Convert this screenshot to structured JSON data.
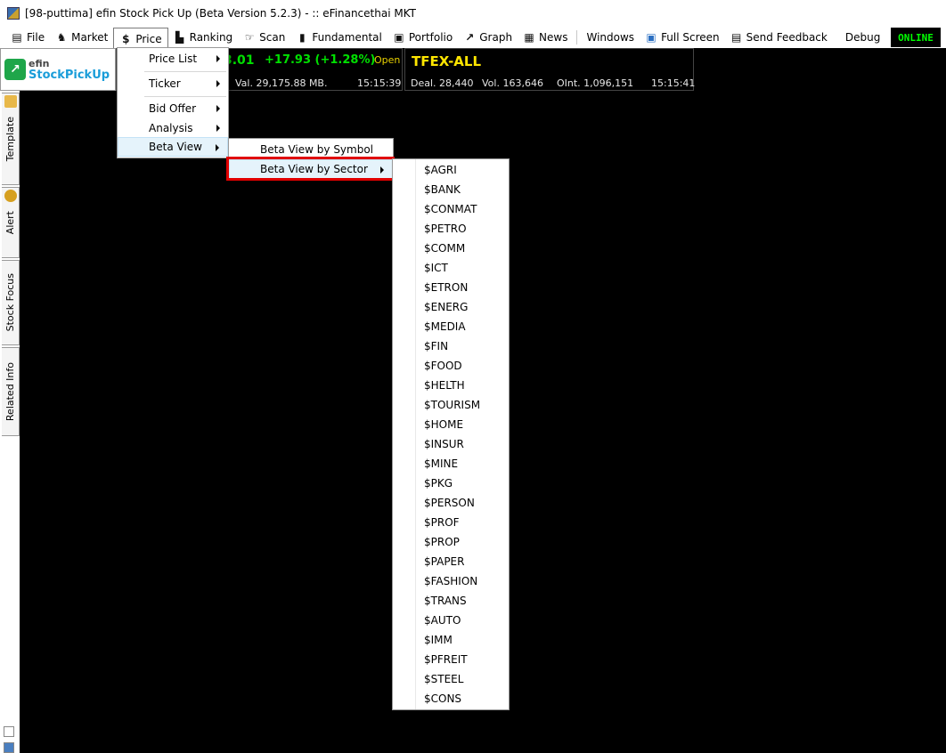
{
  "window": {
    "title": "[98-puttima] efin Stock Pick Up (Beta Version 5.2.3) - :: eFinancethai MKT"
  },
  "menubar": {
    "items": [
      {
        "label": "File",
        "icon": "document-icon"
      },
      {
        "label": "Market",
        "icon": "market-icon"
      },
      {
        "label": "Price",
        "icon": "dollar-icon"
      },
      {
        "label": "Ranking",
        "icon": "ranking-icon"
      },
      {
        "label": "Scan",
        "icon": "scan-icon"
      },
      {
        "label": "Fundamental",
        "icon": "fundamental-icon"
      },
      {
        "label": "Portfolio",
        "icon": "portfolio-icon"
      },
      {
        "label": "Graph",
        "icon": "graph-icon"
      },
      {
        "label": "News",
        "icon": "news-icon"
      },
      {
        "label": "Windows",
        "icon": ""
      },
      {
        "label": "Full Screen",
        "icon": "fullscreen-icon"
      },
      {
        "label": "Send Feedback",
        "icon": "feedback-icon"
      },
      {
        "label": "Debug",
        "icon": ""
      }
    ],
    "status": "ONLINE"
  },
  "logo": {
    "top": "efin",
    "bottom": "StockPickUp"
  },
  "ticker_set": {
    "index_partial": "3.01",
    "change": "+17.93 (+1.28%)",
    "state": "Open",
    "value": "Val. 29,175.88 MB.",
    "time": "15:15:39"
  },
  "ticker_tfex": {
    "name": "TFEX-ALL",
    "deal": "Deal. 28,440",
    "volume": "Vol. 163,646",
    "oint": "OInt. 1,096,151",
    "time": "15:15:41"
  },
  "left_tabs": [
    "Template",
    "Alert",
    "Stock Focus",
    "Related Info"
  ],
  "price_menu": {
    "items": [
      "Price List",
      "Ticker",
      "Bid Offer",
      "Analysis",
      "Beta View"
    ]
  },
  "beta_view_menu": {
    "items": [
      "Beta View by Symbol",
      "Beta View by Sector"
    ]
  },
  "sector_menu": {
    "items": [
      "$AGRI",
      "$BANK",
      "$CONMAT",
      "$PETRO",
      "$COMM",
      "$ICT",
      "$ETRON",
      "$ENERG",
      "$MEDIA",
      "$FIN",
      "$FOOD",
      "$HELTH",
      "$TOURISM",
      "$HOME",
      "$INSUR",
      "$MINE",
      "$PKG",
      "$PERSON",
      "$PROF",
      "$PROP",
      "$PAPER",
      "$FASHION",
      "$TRANS",
      "$AUTO",
      "$IMM",
      "$PFREIT",
      "$STEEL",
      "$CONS"
    ]
  },
  "colors": {
    "ticker_up": "#00e000",
    "ticker_open": "#e8d000",
    "tfex_title": "#ffe600",
    "online": "#00ff00",
    "highlight_border": "#e00000",
    "menu_hover": "#e5f3fb"
  }
}
